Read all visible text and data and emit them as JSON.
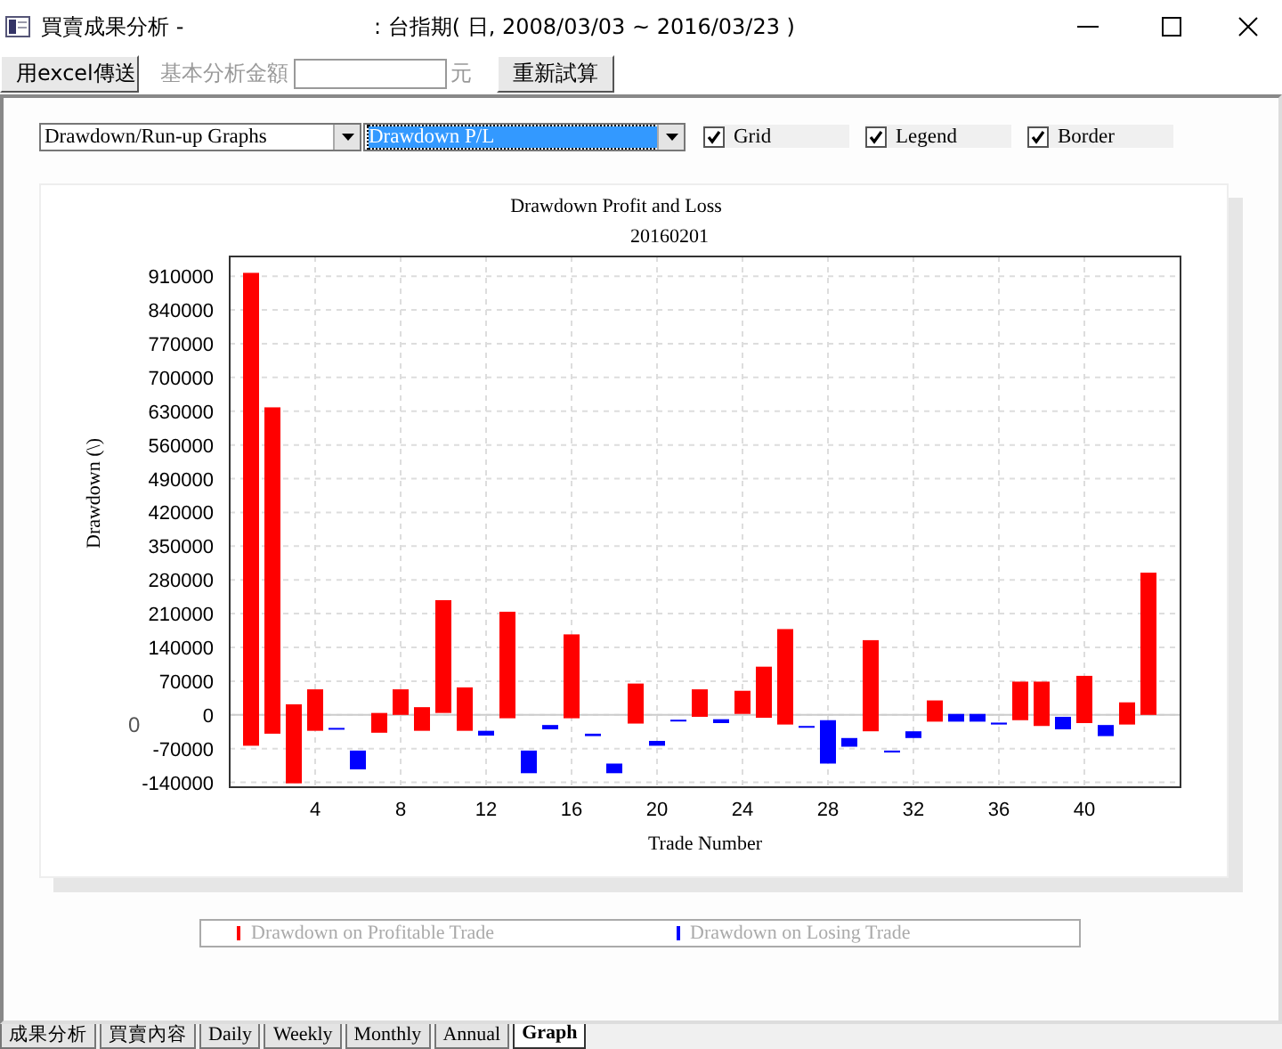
{
  "window": {
    "title": "買賣成果分析 -",
    "subtitle": ": 台指期( 日, 2008/03/03 ~ 2016/03/23 )"
  },
  "toolbar": {
    "export_button": "用excel傳送",
    "amount_label": "基本分析金額",
    "unit": "元",
    "recalc_button": "重新試算"
  },
  "controls": {
    "dropdowns": [
      {
        "value": "Drawdown/Run-up Graphs",
        "focused": false
      },
      {
        "value": "Drawdown P/L",
        "focused": true
      }
    ],
    "checkboxes": [
      {
        "label": "Grid",
        "checked": true
      },
      {
        "label": "Legend",
        "checked": true
      },
      {
        "label": "Border",
        "checked": true
      }
    ]
  },
  "stray_label": "0",
  "chart": {
    "chart_data": {
      "type": "candlestick",
      "grid": true,
      "title": "Drawdown Profit and Loss",
      "subtitle": "20160201",
      "xlabel": "Trade Number",
      "ylabel": "Drawdown (\\)",
      "x": [
        1,
        2,
        3,
        4,
        5,
        6,
        7,
        8,
        9,
        10,
        11,
        12,
        13,
        14,
        15,
        16,
        17,
        18,
        19,
        20,
        21,
        22,
        23,
        24,
        25,
        26,
        27,
        28,
        29,
        30,
        31,
        32,
        33,
        34,
        35,
        36,
        37,
        38,
        39,
        40,
        41,
        42,
        43
      ],
      "xlim": [
        0,
        44.5
      ],
      "ylim": [
        -150000,
        951000
      ],
      "xticks": [
        4,
        8,
        12,
        16,
        20,
        24,
        28,
        32,
        36,
        40
      ],
      "yticks": [
        -140000,
        -70000,
        0,
        70000,
        140000,
        210000,
        280000,
        350000,
        420000,
        490000,
        560000,
        630000,
        700000,
        770000,
        840000,
        910000
      ],
      "series": [
        {
          "name": "Drawdown on Profitable Trade",
          "color": "#ff0000",
          "ohlc": [
            [
              -64000,
              917000,
              -64000,
              917000
            ],
            [
              -39000,
              638000,
              -39000,
              638000
            ],
            [
              -142000,
              22000,
              -142000,
              22000
            ],
            [
              -33000,
              53000,
              -33000,
              53000
            ],
            null,
            null,
            [
              -37000,
              4000,
              -37000,
              4000
            ],
            [
              0,
              53000,
              0,
              53000
            ],
            [
              -33000,
              16000,
              -33000,
              16000
            ],
            [
              4000,
              238000,
              4000,
              238000
            ],
            [
              -33000,
              57000,
              -33000,
              57000
            ],
            null,
            [
              -7000,
              214000,
              -7000,
              214000
            ],
            null,
            null,
            [
              -7000,
              167000,
              -7000,
              167000
            ],
            null,
            null,
            [
              -18000,
              65000,
              -18000,
              65000
            ],
            null,
            null,
            [
              -4000,
              53000,
              -4000,
              53000
            ],
            null,
            [
              2000,
              50000,
              2000,
              50000
            ],
            [
              -6000,
              100000,
              -6000,
              100000
            ],
            [
              -20000,
              178000,
              -20000,
              178000
            ],
            null,
            null,
            null,
            [
              -34000,
              155000,
              -34000,
              155000
            ],
            null,
            null,
            [
              -14000,
              30000,
              -14000,
              30000
            ],
            null,
            null,
            null,
            [
              -11000,
              69000,
              -11000,
              69000
            ],
            [
              -23000,
              69000,
              -23000,
              69000
            ],
            null,
            [
              -17000,
              81000,
              -17000,
              81000
            ],
            null,
            [
              -20000,
              26000,
              -20000,
              26000
            ],
            [
              0,
              295000,
              0,
              295000
            ]
          ]
        },
        {
          "name": "Drawdown on Losing Trade",
          "color": "#0000ff",
          "ohlc": [
            null,
            null,
            null,
            null,
            [
              -27000,
              -27000,
              -29000,
              -29000
            ],
            [
              -74000,
              -74000,
              -113000,
              -113000
            ],
            null,
            null,
            null,
            null,
            null,
            [
              -33000,
              -33000,
              -43000,
              -43000
            ],
            null,
            [
              -74000,
              -74000,
              -121000,
              -121000
            ],
            [
              -21000,
              -21000,
              -30000,
              -30000
            ],
            null,
            [
              -39000,
              -39000,
              -44000,
              -44000
            ],
            [
              -101000,
              -101000,
              -121000,
              -121000
            ],
            null,
            [
              -54000,
              -54000,
              -64000,
              -64000
            ],
            [
              -10000,
              -10000,
              -13000,
              -13000
            ],
            null,
            [
              -9000,
              -9000,
              -17000,
              -17000
            ],
            null,
            null,
            null,
            [
              -23000,
              -23000,
              -26000,
              -26000
            ],
            [
              -11000,
              -11000,
              -101000,
              -101000
            ],
            [
              -48000,
              -48000,
              -66000,
              -66000
            ],
            null,
            [
              -74000,
              -74000,
              -78000,
              -78000
            ],
            [
              -34000,
              -34000,
              -48000,
              -48000
            ],
            null,
            [
              2000,
              2000,
              -14000,
              -14000
            ],
            [
              2000,
              2000,
              -14000,
              -14000
            ],
            [
              -16000,
              -16000,
              -20000,
              -20000
            ],
            null,
            null,
            [
              -4000,
              -4000,
              -30000,
              -30000
            ],
            null,
            [
              -21000,
              -21000,
              -44000,
              -44000
            ],
            null,
            null
          ]
        }
      ]
    }
  },
  "tabs": [
    {
      "label": "成果分析",
      "selected": false
    },
    {
      "label": "買賣內容",
      "selected": false
    },
    {
      "label": "Daily",
      "selected": false
    },
    {
      "label": "Weekly",
      "selected": false
    },
    {
      "label": "Monthly",
      "selected": false
    },
    {
      "label": "Annual",
      "selected": false
    },
    {
      "label": "Graph",
      "selected": true
    }
  ]
}
